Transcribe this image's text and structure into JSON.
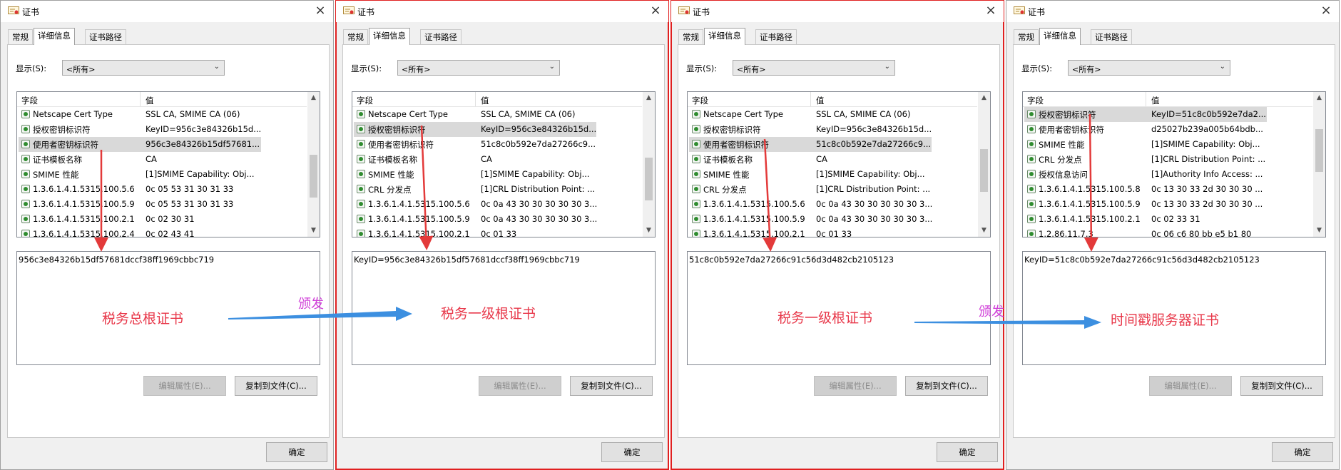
{
  "colors": {
    "highlight": "#e02020",
    "annotation_red": "#e8384a",
    "annotation_purple": "#d040d8",
    "arrow_red": "#e33a3a",
    "arrow_blue": "#3c8fe0"
  },
  "common": {
    "title": "证书",
    "tabs": [
      "常规",
      "详细信息",
      "证书路径"
    ],
    "show_label": "显示(S):",
    "show_value": "<所有>",
    "col_field": "字段",
    "col_value": "值",
    "edit_btn": "编辑属性(E)...",
    "copy_btn": "复制到文件(C)...",
    "ok_btn": "确定"
  },
  "dialogs": [
    {
      "rows": [
        {
          "field": "Netscape Cert Type",
          "value": "SSL CA, SMIME CA (06)"
        },
        {
          "field": "授权密钥标识符",
          "value": "KeyID=956c3e84326b15d..."
        },
        {
          "field": "使用者密钥标识符",
          "value": "956c3e84326b15df57681..."
        },
        {
          "field": "证书模板名称",
          "value": "CA"
        },
        {
          "field": "SMIME 性能",
          "value": "[1]SMIME Capability: Obj..."
        },
        {
          "field": "1.3.6.1.4.1.5315.100.5.6",
          "value": "0c 05 53 31 30 31 33"
        },
        {
          "field": "1.3.6.1.4.1.5315.100.5.9",
          "value": "0c 05 53 31 30 31 33"
        },
        {
          "field": "1.3.6.1.4.1.5315.100.2.1",
          "value": "0c 02 30 31"
        },
        {
          "field": "1.3.6.1.4.1.5315.100.2.4",
          "value": "0c 02 43 41"
        }
      ],
      "selected": 2,
      "detail": "956c3e84326b15df57681dccf38ff1969cbbc719",
      "label": "税务总根证书"
    },
    {
      "rows": [
        {
          "field": "Netscape Cert Type",
          "value": "SSL CA, SMIME CA (06)"
        },
        {
          "field": "授权密钥标识符",
          "value": "KeyID=956c3e84326b15d..."
        },
        {
          "field": "使用者密钥标识符",
          "value": "51c8c0b592e7da27266c9..."
        },
        {
          "field": "证书模板名称",
          "value": "CA"
        },
        {
          "field": "SMIME 性能",
          "value": "[1]SMIME Capability: Obj..."
        },
        {
          "field": "CRL 分发点",
          "value": "[1]CRL Distribution Point: ..."
        },
        {
          "field": "1.3.6.1.4.1.5315.100.5.6",
          "value": "0c 0a 43 30 30 30 30 30 3..."
        },
        {
          "field": "1.3.6.1.4.1.5315.100.5.9",
          "value": "0c 0a 43 30 30 30 30 30 3..."
        },
        {
          "field": "1.3.6.1.4.1.5315.100.2.1",
          "value": "0c 01 33"
        }
      ],
      "selected": 1,
      "detail": "KeyID=956c3e84326b15df57681dccf38ff1969cbbc719",
      "label": "税务一级根证书"
    },
    {
      "rows": [
        {
          "field": "Netscape Cert Type",
          "value": "SSL CA, SMIME CA (06)"
        },
        {
          "field": "授权密钥标识符",
          "value": "KeyID=956c3e84326b15d..."
        },
        {
          "field": "使用者密钥标识符",
          "value": "51c8c0b592e7da27266c9..."
        },
        {
          "field": "证书模板名称",
          "value": "CA"
        },
        {
          "field": "SMIME 性能",
          "value": "[1]SMIME Capability: Obj..."
        },
        {
          "field": "CRL 分发点",
          "value": "[1]CRL Distribution Point: ..."
        },
        {
          "field": "1.3.6.1.4.1.5315.100.5.6",
          "value": "0c 0a 43 30 30 30 30 30 3..."
        },
        {
          "field": "1.3.6.1.4.1.5315.100.5.9",
          "value": "0c 0a 43 30 30 30 30 30 3..."
        },
        {
          "field": "1.3.6.1.4.1.5315.100.2.1",
          "value": "0c 01 33"
        }
      ],
      "selected": 2,
      "detail": "51c8c0b592e7da27266c91c56d3d482cb2105123",
      "label": "税务一级根证书"
    },
    {
      "rows": [
        {
          "field": "授权密钥标识符",
          "value": "KeyID=51c8c0b592e7da2..."
        },
        {
          "field": "使用者密钥标识符",
          "value": "d25027b239a005b64bdb..."
        },
        {
          "field": "SMIME 性能",
          "value": "[1]SMIME Capability: Obj..."
        },
        {
          "field": "CRL 分发点",
          "value": "[1]CRL Distribution Point: ..."
        },
        {
          "field": "授权信息访问",
          "value": "[1]Authority Info Access: ..."
        },
        {
          "field": "1.3.6.1.4.1.5315.100.5.8",
          "value": "0c 13 30 33 2d 30 30 30 ..."
        },
        {
          "field": "1.3.6.1.4.1.5315.100.5.9",
          "value": "0c 13 30 33 2d 30 30 30 ..."
        },
        {
          "field": "1.3.6.1.4.1.5315.100.2.1",
          "value": "0c 02 33 31"
        },
        {
          "field": "1.2.86.11.7.3",
          "value": "0c 06 c6 80 bb e5 b1 80"
        }
      ],
      "selected": 0,
      "detail": "KeyID=51c8c0b592e7da27266c91c56d3d482cb2105123",
      "label": "时间戳服务器证书"
    }
  ],
  "issue_labels": [
    "颁发",
    "颁发"
  ]
}
